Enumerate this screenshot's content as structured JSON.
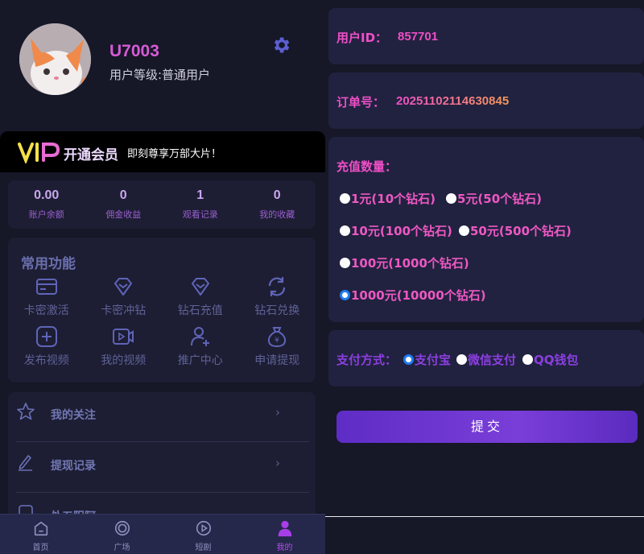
{
  "profile": {
    "username": "U7003",
    "level": "用户等级:普通用户"
  },
  "vip": {
    "logo": "VIP",
    "title": "开通会员",
    "subtitle": "即刻尊享万部大片！"
  },
  "stats": [
    {
      "value": "0.00",
      "label": "账户余额"
    },
    {
      "value": "0",
      "label": "佣金收益"
    },
    {
      "value": "1",
      "label": "观看记录"
    },
    {
      "value": "0",
      "label": "我的收藏"
    }
  ],
  "functions": {
    "title": "常用功能",
    "items": [
      {
        "label": "卡密激活",
        "icon": "card-icon"
      },
      {
        "label": "卡密冲钻",
        "icon": "diamond-icon"
      },
      {
        "label": "钻石充值",
        "icon": "diamond-icon"
      },
      {
        "label": "钻石兑换",
        "icon": "exchange-icon"
      },
      {
        "label": "发布视频",
        "icon": "plus-box-icon"
      },
      {
        "label": "我的视频",
        "icon": "video-icon"
      },
      {
        "label": "推广中心",
        "icon": "add-user-icon"
      },
      {
        "label": "申请提现",
        "icon": "money-bag-icon"
      }
    ]
  },
  "menu": [
    {
      "label": "我的关注",
      "icon": "star-icon"
    },
    {
      "label": "提现记录",
      "icon": "pen-icon"
    },
    {
      "label": "处五阳阿",
      "icon": "list-icon"
    }
  ],
  "tabs": [
    {
      "label": "首页",
      "icon": "home-icon"
    },
    {
      "label": "广场",
      "icon": "circle-icon"
    },
    {
      "label": "短剧",
      "icon": "play-icon"
    },
    {
      "label": "我的",
      "icon": "person-icon",
      "active": true
    }
  ],
  "order": {
    "user_id_label": "用户ID：",
    "user_id": "857701",
    "order_label": "订单号：",
    "order_no": "20251102114630845",
    "amount_label": "充值数量：",
    "options": [
      {
        "label": "1元(10个钻石)",
        "selected": false
      },
      {
        "label": "5元(50个钻石)",
        "selected": false
      },
      {
        "label": "10元(100个钻石)",
        "selected": false
      },
      {
        "label": "50元(500个钻石)",
        "selected": false
      },
      {
        "label": "100元(1000个钻石)",
        "selected": false
      },
      {
        "label": "1000元(10000个钻石)",
        "selected": true
      }
    ],
    "pay_label": "支付方式：",
    "pay_methods": [
      {
        "label": "支付宝",
        "selected": true
      },
      {
        "label": "微信支付",
        "selected": false
      },
      {
        "label": "QQ钱包",
        "selected": false
      }
    ],
    "submit": "提交"
  }
}
